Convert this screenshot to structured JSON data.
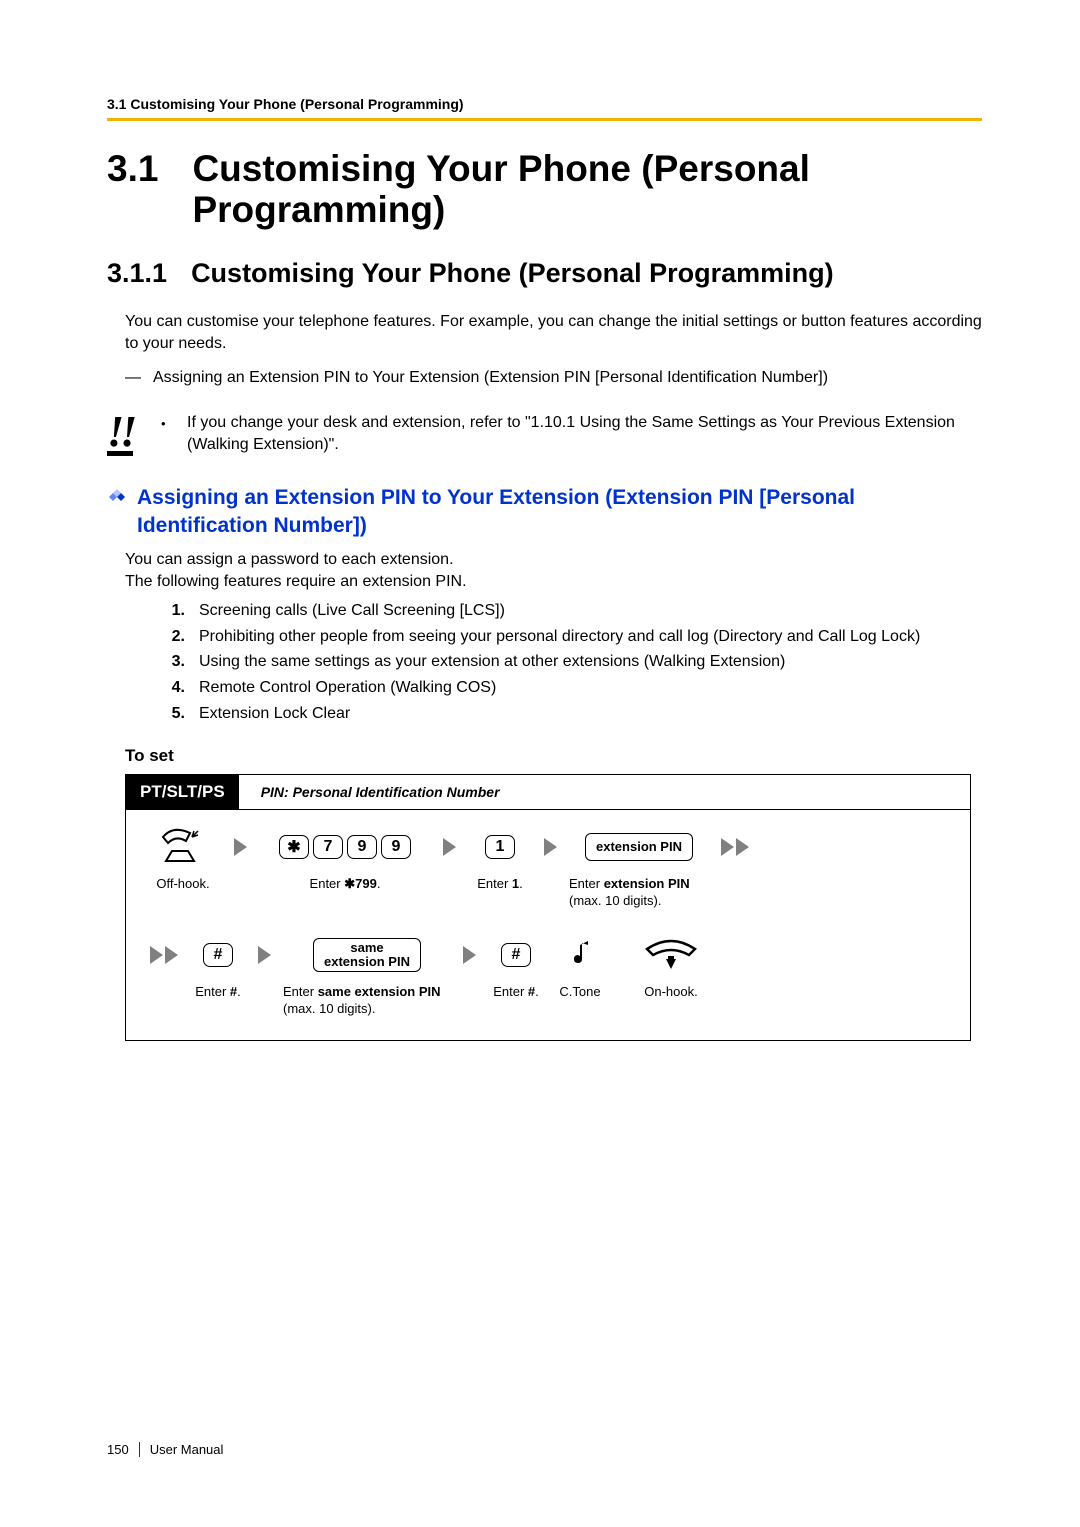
{
  "running_header": "3.1 Customising Your Phone (Personal Programming)",
  "h1": {
    "num": "3.1",
    "title": "Customising Your Phone (Personal Programming)"
  },
  "h2": {
    "num": "3.1.1",
    "title": "Customising Your Phone (Personal Programming)"
  },
  "intro": "You can customise your telephone features. For example, you can change the initial settings or button features according to your needs.",
  "dash_item": "Assigning an Extension PIN to Your Extension (Extension PIN [Personal Identification Number])",
  "note": "If you change your desk and extension, refer to \"1.10.1 Using the Same Settings as Your Previous Extension (Walking Extension)\".",
  "blue_heading": "Assigning an Extension PIN to Your Extension (Extension PIN [Personal Identification Number])",
  "pin_intro1": "You can assign a password to each extension.",
  "pin_intro2": "The following features require an extension PIN.",
  "ol": [
    "Screening calls (Live Call Screening [LCS])",
    "Prohibiting other people from seeing your personal directory and call log (Directory and Call Log Lock)",
    "Using the same settings as your extension at other extensions (Walking Extension)",
    "Remote Control Operation (Walking COS)",
    "Extension Lock Clear"
  ],
  "to_set": "To set",
  "diagram": {
    "badge": "PT/SLT/PS",
    "desc": "PIN: Personal Identification Number",
    "row1": {
      "offhook": "Off-hook.",
      "keys": [
        "✱",
        "7",
        "9",
        "9"
      ],
      "keys_caption_prefix": "Enter ",
      "keys_caption_code": "✱799",
      "keys_caption_suffix": ".",
      "one_key": "1",
      "one_caption_prefix": "Enter ",
      "one_caption_bold": "1",
      "one_caption_suffix": ".",
      "extpin": "extension PIN",
      "extpin_caption_prefix": "Enter ",
      "extpin_caption_bold": "extension PIN",
      "extpin_caption_line2": " (max. 10 digits)."
    },
    "row2": {
      "hash1": "#",
      "hash1_caption_prefix": "Enter ",
      "hash1_caption_bold": "#",
      "hash1_caption_suffix": ".",
      "same_line1": "same",
      "same_line2": "extension PIN",
      "same_caption_prefix": "Enter ",
      "same_caption_bold": "same extension PIN",
      "same_caption_line2": " (max. 10 digits).",
      "hash2": "#",
      "hash2_caption_prefix": "Enter ",
      "hash2_caption_bold": "#",
      "hash2_caption_suffix": ".",
      "ctone": "C.Tone",
      "onhook": "On-hook."
    }
  },
  "footer": {
    "page": "150",
    "label": "User Manual"
  }
}
